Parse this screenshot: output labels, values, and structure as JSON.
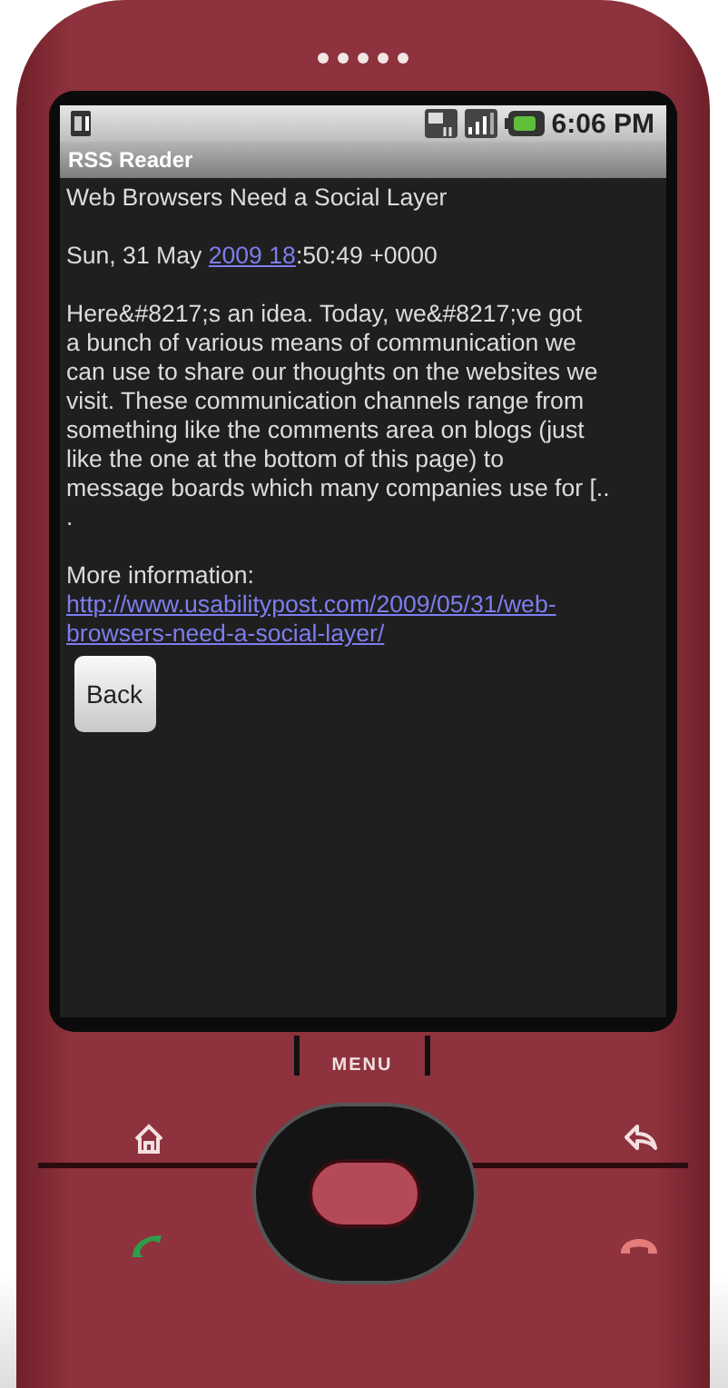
{
  "status_bar": {
    "time": "6:06 PM"
  },
  "app_title": "RSS Reader",
  "article": {
    "title": "Web Browsers Need a Social Layer",
    "date_before": "Sun, 31 May ",
    "date_link": "2009 18",
    "date_after": ":50:49 +0000",
    "body": "Here&#8217;s an idea. Today, we&#8217;ve got\na bunch of various means of communication we\ncan use to share our thoughts on the websites we\nvisit. These communication channels range from\nsomething like the comments area on blogs (just\nlike the one at the bottom of this page) to\nmessage boards which many companies use for [..\n.",
    "more_label": "More information:",
    "url": "http://www.usabilitypost.com/2009/05/31/web-\nbrowsers-need-a-social-layer/"
  },
  "back_button": "Back",
  "menu_label": "MENU"
}
